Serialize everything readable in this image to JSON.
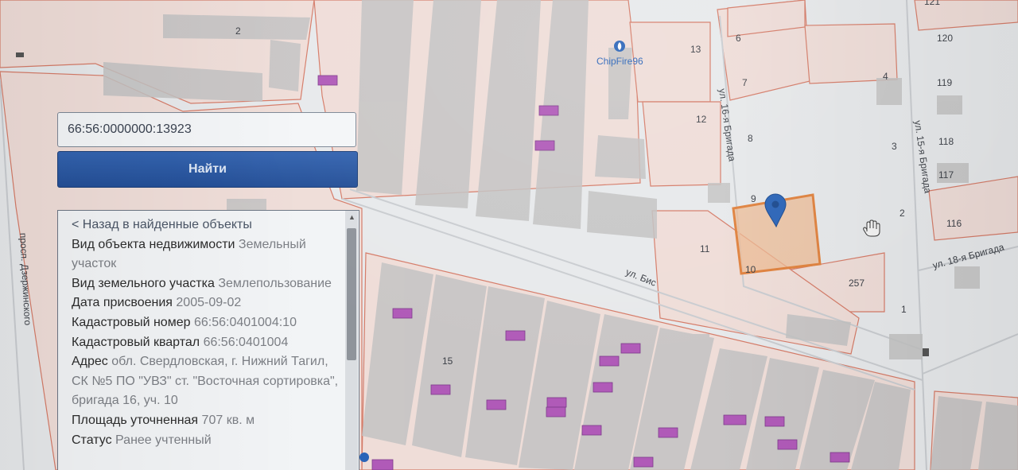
{
  "search": {
    "value": "66:56:0000000:13923",
    "button_label": "Найти"
  },
  "info": {
    "back_link": "< Назад в найденные объекты",
    "rows": [
      {
        "label": "Вид объекта недвижимости",
        "value": "Земельный участок"
      },
      {
        "label": "Вид земельного участка",
        "value": "Землепользование"
      },
      {
        "label": "Дата присвоения",
        "value": "2005-09-02"
      },
      {
        "label": "Кадастровый номер",
        "value": "66:56:0401004:10"
      },
      {
        "label": "Кадастровый квартал",
        "value": "66:56:0401004"
      },
      {
        "label": "Адрес",
        "value": "обл. Свердловская, г. Нижний Тагил, СК №5 ПО \"УВЗ\" ст. \"Восточная сортировка\", бригада 16, уч. 10"
      },
      {
        "label": "Площадь уточненная",
        "value": "707 кв. м"
      },
      {
        "label": "Статус",
        "value": "Ранее учтенный"
      }
    ]
  },
  "map": {
    "poi_label": "ChipFire96",
    "streets": {
      "brigada16": "ул. 16-я Бригада",
      "brigada15": "ул. 15-я Бригада",
      "brigada18": "ул. 18-я Бригада",
      "bis": "ул. Бис",
      "dzerzhinsky": "просп. Дзержинского"
    },
    "labels": {
      "p2": "2",
      "p13": "13",
      "p6": "6",
      "p7": "7",
      "p12": "12",
      "p8": "8",
      "p9": "9",
      "p11": "11",
      "p10": "10",
      "p4": "4",
      "p3": "3",
      "p2b": "2",
      "p1": "1",
      "p257": "257",
      "p15": "15",
      "p121": "121",
      "p120": "120",
      "p119": "119",
      "p118": "118",
      "p117": "117",
      "p116": "116"
    },
    "colors": {
      "parcel_border": "#d4705a",
      "selected_parcel": "#e0823e",
      "marker": "#2a64b8",
      "building": "#bcbcbc",
      "small_building": "#b05ab8"
    },
    "icons": {
      "poi": "fire-poi-icon",
      "marker": "map-marker-icon",
      "cursor": "hand-cursor-icon"
    }
  }
}
